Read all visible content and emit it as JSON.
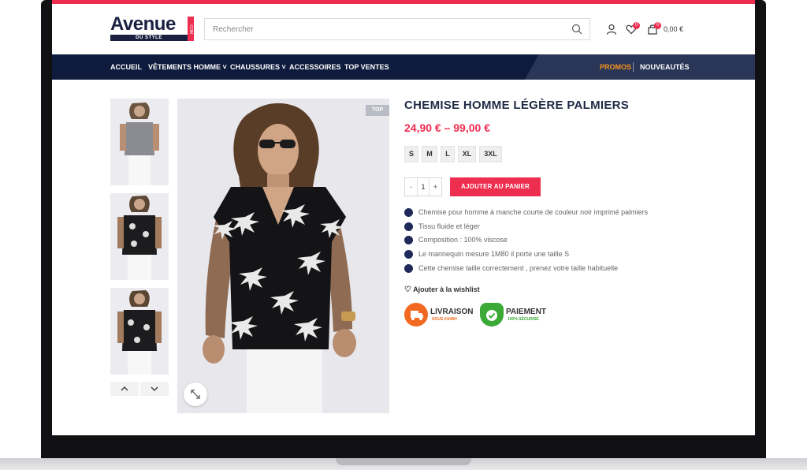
{
  "brand": {
    "main": "Avenue",
    "sub": "DU STYLE",
    "tld": ".COM"
  },
  "search": {
    "placeholder": "Rechercher"
  },
  "header": {
    "wishlist_count": "0",
    "cart_count": "0",
    "cart_total": "0,00 €"
  },
  "nav": {
    "items": [
      {
        "label": "ACCUEIL"
      },
      {
        "label": "VÊTEMENTS HOMME ˅"
      },
      {
        "label": "CHAUSSURES ˅"
      },
      {
        "label": "ACCESSOIRES"
      },
      {
        "label": "TOP VENTES"
      }
    ],
    "right": [
      {
        "label": "PROMOS"
      },
      {
        "label": "NOUVEAUTÉS"
      }
    ]
  },
  "gallery": {
    "badge": "TOP"
  },
  "product": {
    "title": "CHEMISE HOMME LÉGÈRE PALMIERS",
    "price": "24,90 € – 99,00 €",
    "sizes": [
      "S",
      "M",
      "L",
      "XL",
      "3XL"
    ],
    "qty": {
      "minus": "-",
      "value": "1",
      "plus": "+"
    },
    "add_to_cart": "AJOUTER AU PANIER",
    "features": [
      "Chemise pour homme  à manche courte de couleur noir imprimé palmiers",
      "Tissu fluide et léger",
      "Composition : 100% viscose",
      "Le mannequin mesure 1M80 il porte une taille S",
      "Cette chemise taille correctement , prenez votre taille habituelle"
    ],
    "wishlist": "Ajouter à la wishlist"
  },
  "trust": [
    {
      "title": "LIVRAISON",
      "sub": "SOUS 24/48H",
      "color": "#f26a21"
    },
    {
      "title": "PAIEMENT",
      "sub": "100% SÉCURISÉ",
      "color": "#3aa935"
    }
  ],
  "colors": {
    "accent": "#ee2e4f",
    "navy": "#0f1b3d",
    "promo": "#f7941d"
  }
}
